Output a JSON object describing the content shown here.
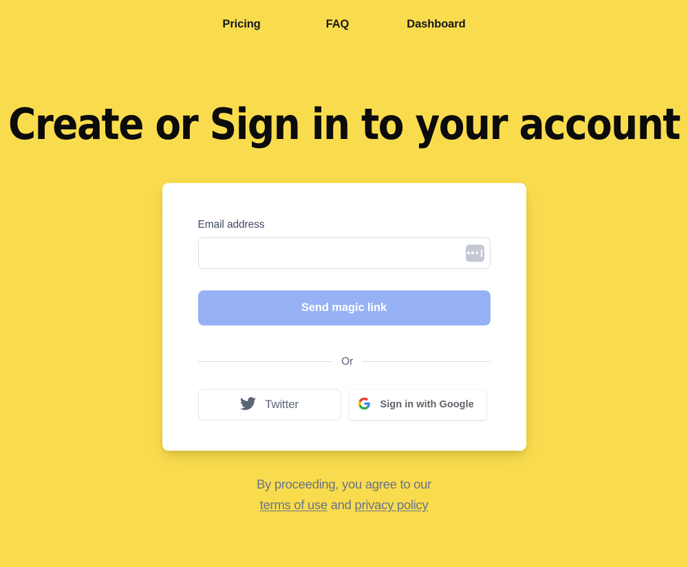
{
  "colors": {
    "background": "#f9dc4e",
    "card": "#ffffff",
    "primary_button": "#97b1f5",
    "heading_text": "#0b0b0c",
    "muted_text": "#6a7386",
    "input_border": "#dcdfe6",
    "google_blue": "#4285f4",
    "google_red": "#ea4335",
    "google_yellow": "#fbbc05",
    "google_green": "#34a853",
    "twitter_icon": "#5b6477"
  },
  "nav": {
    "items": [
      {
        "label": "Pricing",
        "name": "nav-link-pricing"
      },
      {
        "label": "FAQ",
        "name": "nav-link-faq"
      },
      {
        "label": "Dashboard",
        "name": "nav-link-dashboard"
      }
    ]
  },
  "hero": {
    "title": "Create or Sign in to your account"
  },
  "form": {
    "email_label": "Email address",
    "email_value": "",
    "email_placeholder": "",
    "autofill_icon": "password-manager-dots-icon",
    "submit_label": "Send magic link",
    "divider_label": "Or"
  },
  "social": {
    "twitter": {
      "label": "Twitter",
      "icon": "twitter-bird-icon"
    },
    "google": {
      "label": "Sign in with Google",
      "icon": "google-g-icon"
    }
  },
  "legal": {
    "prefix": "By proceeding, you agree to our",
    "terms_label": "terms of use",
    "conjunction": " and ",
    "privacy_label": "privacy policy"
  }
}
